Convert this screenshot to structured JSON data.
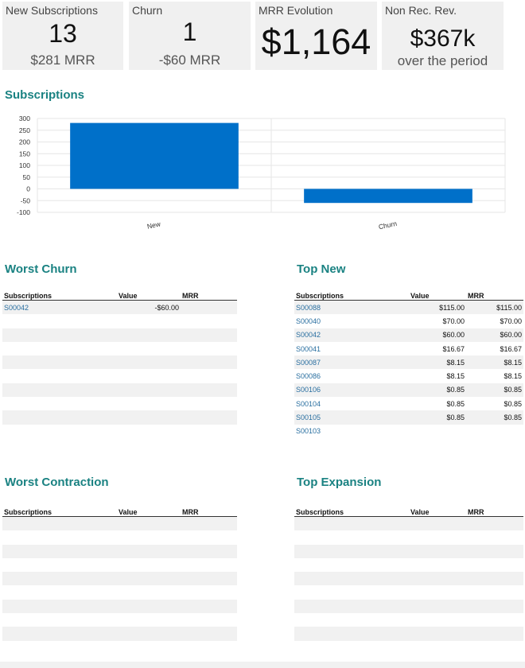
{
  "kpis": {
    "new_subscriptions": {
      "title": "New Subscriptions",
      "value": "13",
      "sub": "$281 MRR"
    },
    "churn": {
      "title": "Churn",
      "value": "1",
      "sub": "-$60 MRR"
    },
    "mrr_evolution": {
      "title": "MRR Evolution",
      "value": "$1,164"
    },
    "non_rec_rev": {
      "title": "Non Rec. Rev.",
      "value": "$367k",
      "sub": "over the period"
    }
  },
  "subscriptions_section": {
    "title": "Subscriptions"
  },
  "chart_data": {
    "type": "bar",
    "categories": [
      "New",
      "Churn"
    ],
    "values": [
      281,
      -60
    ],
    "ylim": [
      -100,
      300
    ],
    "yticks": [
      300,
      250,
      200,
      150,
      100,
      50,
      0,
      -50,
      -100
    ],
    "grid": true,
    "bar_color": "#0070c9"
  },
  "worst_churn": {
    "title": "Worst Churn",
    "headers": {
      "subscriptions": "Subscriptions",
      "value": "Value",
      "mrr": "MRR"
    },
    "rows": [
      {
        "sub": "S00042",
        "value": "-$60.00",
        "mrr": ""
      }
    ]
  },
  "top_new": {
    "title": "Top New",
    "headers": {
      "subscriptions": "Subscriptions",
      "value": "Value",
      "mrr": "MRR"
    },
    "rows": [
      {
        "sub": "S00088",
        "value": "$115.00",
        "mrr": "$115.00"
      },
      {
        "sub": "S00040",
        "value": "$70.00",
        "mrr": "$70.00"
      },
      {
        "sub": "S00042",
        "value": "$60.00",
        "mrr": "$60.00"
      },
      {
        "sub": "S00041",
        "value": "$16.67",
        "mrr": "$16.67"
      },
      {
        "sub": "S00087",
        "value": "$8.15",
        "mrr": "$8.15"
      },
      {
        "sub": "S00086",
        "value": "$8.15",
        "mrr": "$8.15"
      },
      {
        "sub": "S00106",
        "value": "$0.85",
        "mrr": "$0.85"
      },
      {
        "sub": "S00104",
        "value": "$0.85",
        "mrr": "$0.85"
      },
      {
        "sub": "S00105",
        "value": "$0.85",
        "mrr": "$0.85"
      },
      {
        "sub": "S00103",
        "value": "",
        "mrr": ""
      }
    ]
  },
  "worst_contraction": {
    "title": "Worst Contraction",
    "headers": {
      "subscriptions": "Subscriptions",
      "value": "Value",
      "mrr": "MRR"
    }
  },
  "top_expansion": {
    "title": "Top Expansion",
    "headers": {
      "subscriptions": "Subscriptions",
      "value": "Value",
      "mrr": "MRR"
    }
  }
}
